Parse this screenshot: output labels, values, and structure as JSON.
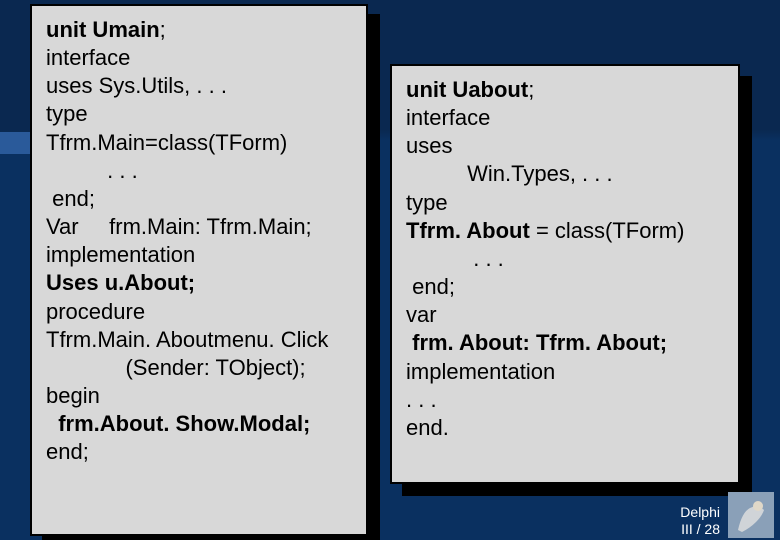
{
  "left": {
    "l1": "unit Umain",
    "semi1": ";",
    "l2": "interface",
    "l3": "uses Sys.Utils, . . .",
    "l4": "type",
    "l5": "Tfrm.Main=class(TForm)",
    "l6": "          . . .",
    "l7": " end;",
    "l8a": "Var",
    "l8b": "     frm.Main: Tfrm.Main;",
    "l9": "implementation",
    "l10": "Uses u.About;",
    "l11": "procedure",
    "l12": "Tfrm.Main. Aboutmenu. Click",
    "l13": "             (Sender: TObject);",
    "l14": "begin",
    "l15": "  frm.About. Show.Modal;",
    "l16": "end;"
  },
  "right": {
    "r1": "unit Uabout",
    "semi1": ";",
    "r2": "interface",
    "r3": "uses",
    "r4": "          Win.Types, . . .",
    "r5": "type",
    "r6": "Tfrm. About",
    "r6b": " = class(TForm)",
    "r7": "           . . .",
    "r8": " end;",
    "r9": "var",
    "r10": " frm. About: Tfrm. About;",
    "r11": "implementation",
    "r12": ". . .",
    "r13": "end."
  },
  "footer": {
    "line1": "Delphi",
    "line2": "III / 28"
  }
}
